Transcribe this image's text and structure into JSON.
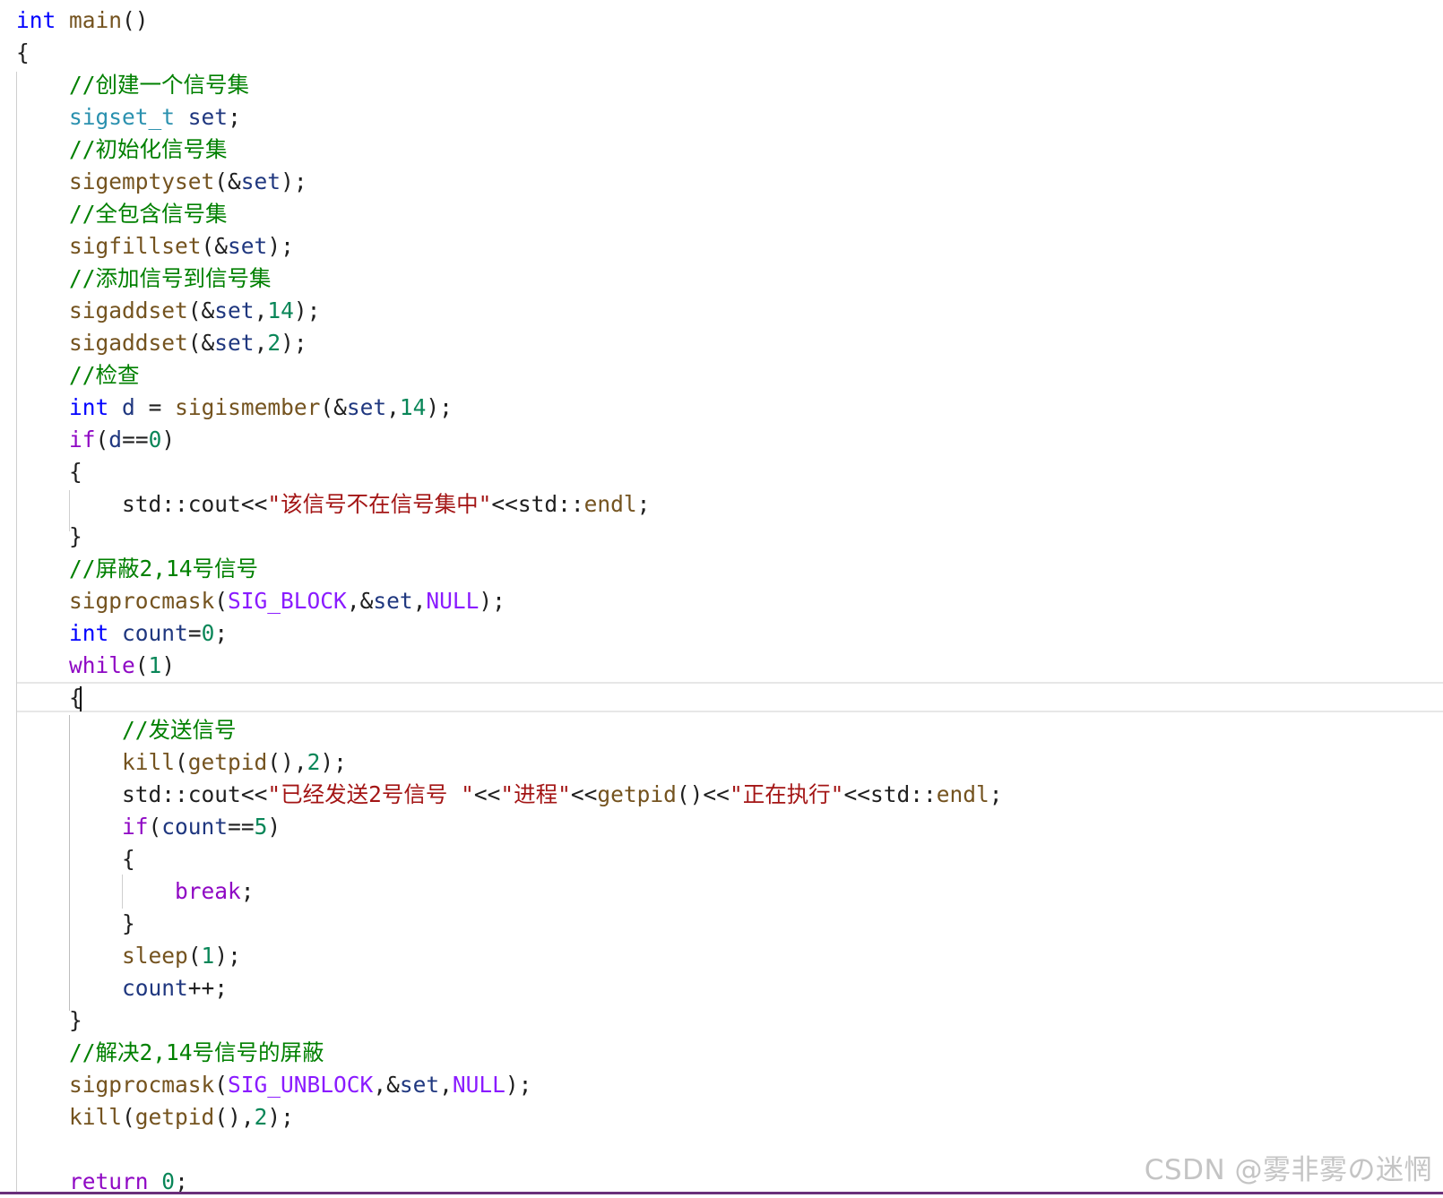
{
  "colors": {
    "keyword": "#0000ff",
    "control": "#8f08c4",
    "type": "#2b91af",
    "function": "#74531f",
    "variable": "#1f377f",
    "number": "#098658",
    "string": "#a31515",
    "comment": "#008000",
    "macro": "#8a1bff",
    "plain": "#1f1f1f"
  },
  "code_lines": [
    [
      {
        "t": "int",
        "c": "keyword"
      },
      {
        "t": " ",
        "c": "plain"
      },
      {
        "t": "main",
        "c": "function"
      },
      {
        "t": "()",
        "c": "plain"
      }
    ],
    [
      {
        "t": "{",
        "c": "plain"
      }
    ],
    [
      {
        "t": "    ",
        "c": "plain"
      },
      {
        "t": "//创建一个信号集",
        "c": "comment"
      }
    ],
    [
      {
        "t": "    ",
        "c": "plain"
      },
      {
        "t": "sigset_t",
        "c": "type"
      },
      {
        "t": " ",
        "c": "plain"
      },
      {
        "t": "set",
        "c": "variable"
      },
      {
        "t": ";",
        "c": "plain"
      }
    ],
    [
      {
        "t": "    ",
        "c": "plain"
      },
      {
        "t": "//初始化信号集",
        "c": "comment"
      }
    ],
    [
      {
        "t": "    ",
        "c": "plain"
      },
      {
        "t": "sigemptyset",
        "c": "function"
      },
      {
        "t": "(&",
        "c": "plain"
      },
      {
        "t": "set",
        "c": "variable"
      },
      {
        "t": ");",
        "c": "plain"
      }
    ],
    [
      {
        "t": "    ",
        "c": "plain"
      },
      {
        "t": "//全包含信号集",
        "c": "comment"
      }
    ],
    [
      {
        "t": "    ",
        "c": "plain"
      },
      {
        "t": "sigfillset",
        "c": "function"
      },
      {
        "t": "(&",
        "c": "plain"
      },
      {
        "t": "set",
        "c": "variable"
      },
      {
        "t": ");",
        "c": "plain"
      }
    ],
    [
      {
        "t": "    ",
        "c": "plain"
      },
      {
        "t": "//添加信号到信号集",
        "c": "comment"
      }
    ],
    [
      {
        "t": "    ",
        "c": "plain"
      },
      {
        "t": "sigaddset",
        "c": "function"
      },
      {
        "t": "(&",
        "c": "plain"
      },
      {
        "t": "set",
        "c": "variable"
      },
      {
        "t": ",",
        "c": "plain"
      },
      {
        "t": "14",
        "c": "number"
      },
      {
        "t": ");",
        "c": "plain"
      }
    ],
    [
      {
        "t": "    ",
        "c": "plain"
      },
      {
        "t": "sigaddset",
        "c": "function"
      },
      {
        "t": "(&",
        "c": "plain"
      },
      {
        "t": "set",
        "c": "variable"
      },
      {
        "t": ",",
        "c": "plain"
      },
      {
        "t": "2",
        "c": "number"
      },
      {
        "t": ");",
        "c": "plain"
      }
    ],
    [
      {
        "t": "    ",
        "c": "plain"
      },
      {
        "t": "//检查",
        "c": "comment"
      }
    ],
    [
      {
        "t": "    ",
        "c": "plain"
      },
      {
        "t": "int",
        "c": "keyword"
      },
      {
        "t": " ",
        "c": "plain"
      },
      {
        "t": "d",
        "c": "variable"
      },
      {
        "t": " = ",
        "c": "plain"
      },
      {
        "t": "sigismember",
        "c": "function"
      },
      {
        "t": "(&",
        "c": "plain"
      },
      {
        "t": "set",
        "c": "variable"
      },
      {
        "t": ",",
        "c": "plain"
      },
      {
        "t": "14",
        "c": "number"
      },
      {
        "t": ");",
        "c": "plain"
      }
    ],
    [
      {
        "t": "    ",
        "c": "plain"
      },
      {
        "t": "if",
        "c": "control"
      },
      {
        "t": "(",
        "c": "plain"
      },
      {
        "t": "d",
        "c": "variable"
      },
      {
        "t": "==",
        "c": "plain"
      },
      {
        "t": "0",
        "c": "number"
      },
      {
        "t": ")",
        "c": "plain"
      }
    ],
    [
      {
        "t": "    ",
        "c": "plain"
      },
      {
        "t": "{",
        "c": "plain"
      }
    ],
    [
      {
        "t": "        ",
        "c": "plain"
      },
      {
        "t": "std",
        "c": "plain"
      },
      {
        "t": "::",
        "c": "plain"
      },
      {
        "t": "cout",
        "c": "plain"
      },
      {
        "t": "<<",
        "c": "plain"
      },
      {
        "t": "\"该信号不在信号集中\"",
        "c": "string"
      },
      {
        "t": "<<",
        "c": "plain"
      },
      {
        "t": "std",
        "c": "plain"
      },
      {
        "t": "::",
        "c": "plain"
      },
      {
        "t": "endl",
        "c": "function"
      },
      {
        "t": ";",
        "c": "plain"
      }
    ],
    [
      {
        "t": "    ",
        "c": "plain"
      },
      {
        "t": "}",
        "c": "plain"
      }
    ],
    [
      {
        "t": "    ",
        "c": "plain"
      },
      {
        "t": "//屏蔽2,14号信号",
        "c": "comment"
      }
    ],
    [
      {
        "t": "    ",
        "c": "plain"
      },
      {
        "t": "sigprocmask",
        "c": "function"
      },
      {
        "t": "(",
        "c": "plain"
      },
      {
        "t": "SIG_BLOCK",
        "c": "macro"
      },
      {
        "t": ",&",
        "c": "plain"
      },
      {
        "t": "set",
        "c": "variable"
      },
      {
        "t": ",",
        "c": "plain"
      },
      {
        "t": "NULL",
        "c": "macro"
      },
      {
        "t": ");",
        "c": "plain"
      }
    ],
    [
      {
        "t": "    ",
        "c": "plain"
      },
      {
        "t": "int",
        "c": "keyword"
      },
      {
        "t": " ",
        "c": "plain"
      },
      {
        "t": "count",
        "c": "variable"
      },
      {
        "t": "=",
        "c": "plain"
      },
      {
        "t": "0",
        "c": "number"
      },
      {
        "t": ";",
        "c": "plain"
      }
    ],
    [
      {
        "t": "    ",
        "c": "plain"
      },
      {
        "t": "while",
        "c": "control"
      },
      {
        "t": "(",
        "c": "plain"
      },
      {
        "t": "1",
        "c": "number"
      },
      {
        "t": ")",
        "c": "plain"
      }
    ],
    [
      {
        "t": "    ",
        "c": "plain"
      },
      {
        "t": "{",
        "c": "plain"
      }
    ],
    [
      {
        "t": "        ",
        "c": "plain"
      },
      {
        "t": "//发送信号",
        "c": "comment"
      }
    ],
    [
      {
        "t": "        ",
        "c": "plain"
      },
      {
        "t": "kill",
        "c": "function"
      },
      {
        "t": "(",
        "c": "plain"
      },
      {
        "t": "getpid",
        "c": "function"
      },
      {
        "t": "(),",
        "c": "plain"
      },
      {
        "t": "2",
        "c": "number"
      },
      {
        "t": ");",
        "c": "plain"
      }
    ],
    [
      {
        "t": "        ",
        "c": "plain"
      },
      {
        "t": "std",
        "c": "plain"
      },
      {
        "t": "::",
        "c": "plain"
      },
      {
        "t": "cout",
        "c": "plain"
      },
      {
        "t": "<<",
        "c": "plain"
      },
      {
        "t": "\"已经发送2号信号 \"",
        "c": "string"
      },
      {
        "t": "<<",
        "c": "plain"
      },
      {
        "t": "\"进程\"",
        "c": "string"
      },
      {
        "t": "<<",
        "c": "plain"
      },
      {
        "t": "getpid",
        "c": "function"
      },
      {
        "t": "()",
        "c": "plain"
      },
      {
        "t": "<<",
        "c": "plain"
      },
      {
        "t": "\"正在执行\"",
        "c": "string"
      },
      {
        "t": "<<",
        "c": "plain"
      },
      {
        "t": "std",
        "c": "plain"
      },
      {
        "t": "::",
        "c": "plain"
      },
      {
        "t": "endl",
        "c": "function"
      },
      {
        "t": ";",
        "c": "plain"
      }
    ],
    [
      {
        "t": "        ",
        "c": "plain"
      },
      {
        "t": "if",
        "c": "control"
      },
      {
        "t": "(",
        "c": "plain"
      },
      {
        "t": "count",
        "c": "variable"
      },
      {
        "t": "==",
        "c": "plain"
      },
      {
        "t": "5",
        "c": "number"
      },
      {
        "t": ")",
        "c": "plain"
      }
    ],
    [
      {
        "t": "        ",
        "c": "plain"
      },
      {
        "t": "{",
        "c": "plain"
      }
    ],
    [
      {
        "t": "            ",
        "c": "plain"
      },
      {
        "t": "break",
        "c": "control"
      },
      {
        "t": ";",
        "c": "plain"
      }
    ],
    [
      {
        "t": "        ",
        "c": "plain"
      },
      {
        "t": "}",
        "c": "plain"
      }
    ],
    [
      {
        "t": "        ",
        "c": "plain"
      },
      {
        "t": "sleep",
        "c": "function"
      },
      {
        "t": "(",
        "c": "plain"
      },
      {
        "t": "1",
        "c": "number"
      },
      {
        "t": ");",
        "c": "plain"
      }
    ],
    [
      {
        "t": "        ",
        "c": "plain"
      },
      {
        "t": "count",
        "c": "variable"
      },
      {
        "t": "++;",
        "c": "plain"
      }
    ],
    [
      {
        "t": "    ",
        "c": "plain"
      },
      {
        "t": "}",
        "c": "plain"
      }
    ],
    [
      {
        "t": "    ",
        "c": "plain"
      },
      {
        "t": "//解决2,14号信号的屏蔽",
        "c": "comment"
      }
    ],
    [
      {
        "t": "    ",
        "c": "plain"
      },
      {
        "t": "sigprocmask",
        "c": "function"
      },
      {
        "t": "(",
        "c": "plain"
      },
      {
        "t": "SIG_UNBLOCK",
        "c": "macro"
      },
      {
        "t": ",&",
        "c": "plain"
      },
      {
        "t": "set",
        "c": "variable"
      },
      {
        "t": ",",
        "c": "plain"
      },
      {
        "t": "NULL",
        "c": "macro"
      },
      {
        "t": ");",
        "c": "plain"
      }
    ],
    [
      {
        "t": "    ",
        "c": "plain"
      },
      {
        "t": "kill",
        "c": "function"
      },
      {
        "t": "(",
        "c": "plain"
      },
      {
        "t": "getpid",
        "c": "function"
      },
      {
        "t": "(),",
        "c": "plain"
      },
      {
        "t": "2",
        "c": "number"
      },
      {
        "t": ");",
        "c": "plain"
      }
    ],
    [],
    [
      {
        "t": "    ",
        "c": "plain"
      },
      {
        "t": "return",
        "c": "control"
      },
      {
        "t": " ",
        "c": "plain"
      },
      {
        "t": "0",
        "c": "number"
      },
      {
        "t": ";",
        "c": "plain"
      }
    ]
  ],
  "watermark": "CSDN @雾非雾の迷惘"
}
